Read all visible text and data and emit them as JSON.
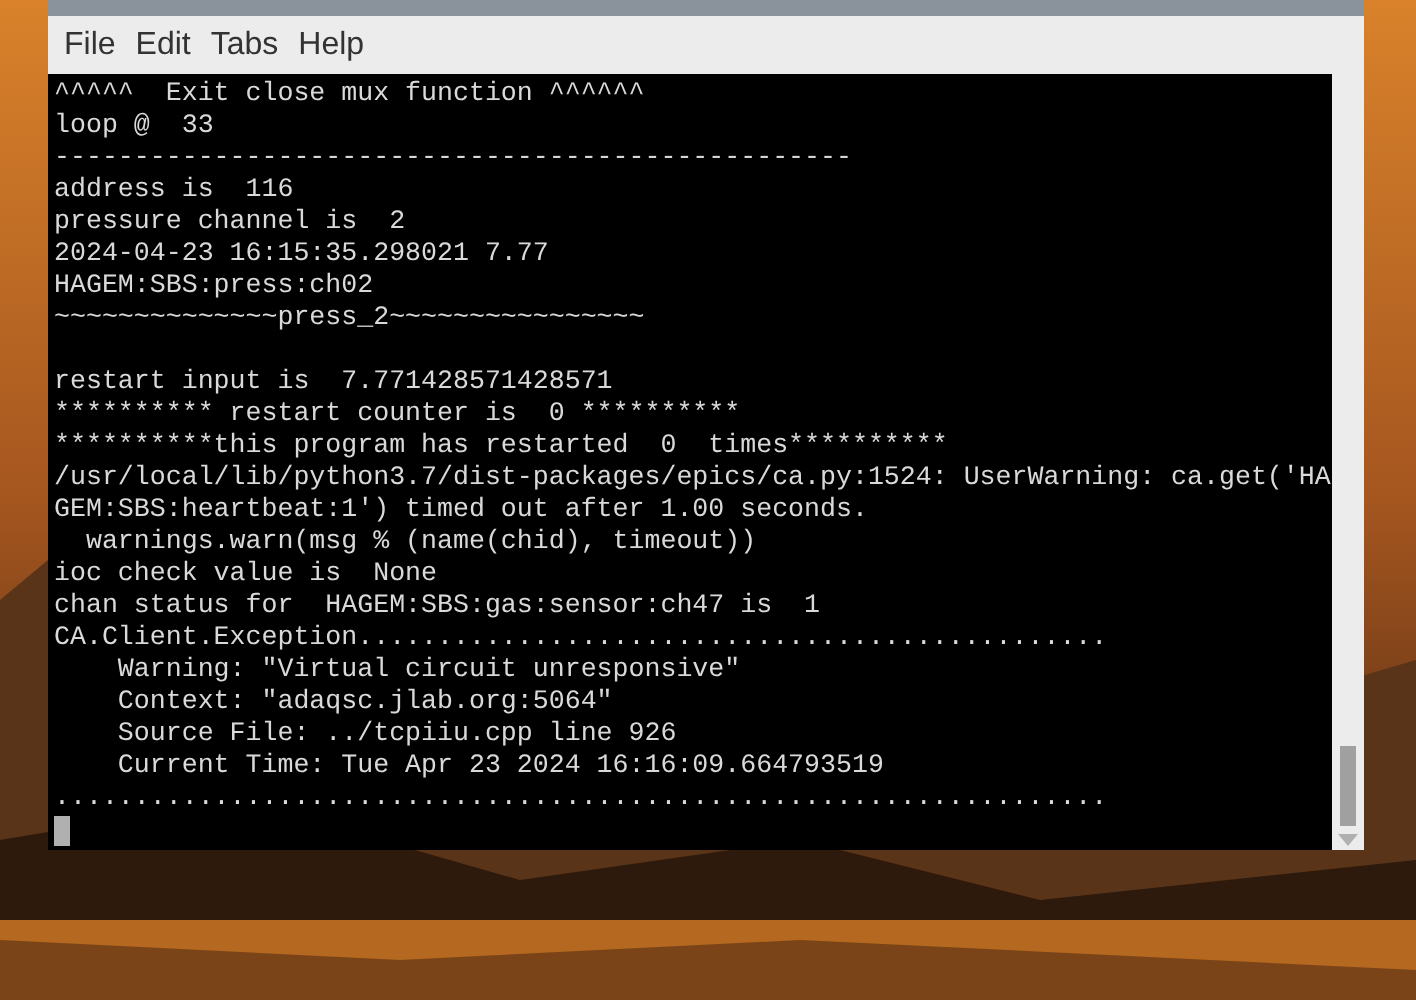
{
  "menu": [
    "File",
    "Edit",
    "Tabs",
    "Help"
  ],
  "terminal": {
    "lines": [
      {
        "kind": "text",
        "text": "^^^^^  Exit close mux function ^^^^^^"
      },
      {
        "kind": "text",
        "text": "loop @  33"
      },
      {
        "kind": "text",
        "text": "--------------------------------------------------"
      },
      {
        "kind": "text",
        "text": "address is  116"
      },
      {
        "kind": "text",
        "text": "pressure channel is  2"
      },
      {
        "kind": "text",
        "text": "2024-04-23 16:15:35.298021 7.77"
      },
      {
        "kind": "text",
        "text": "HAGEM:SBS:press:ch02"
      },
      {
        "kind": "text",
        "text": "~~~~~~~~~~~~~~press_2~~~~~~~~~~~~~~~~"
      },
      {
        "kind": "blank"
      },
      {
        "kind": "text",
        "text": "restart input is  7.771428571428571"
      },
      {
        "kind": "text",
        "text": "********** restart counter is  0 **********"
      },
      {
        "kind": "text",
        "text": "**********this program has restarted  0  times**********"
      },
      {
        "kind": "text",
        "text": "/usr/local/lib/python3.7/dist-packages/epics/ca.py:1524: UserWarning: ca.get('HA"
      },
      {
        "kind": "text",
        "text": "GEM:SBS:heartbeat:1') timed out after 1.00 seconds."
      },
      {
        "kind": "text",
        "text": "  warnings.warn(msg % (name(chid), timeout))"
      },
      {
        "kind": "text",
        "text": "ioc check value is  None"
      },
      {
        "kind": "text",
        "text": "chan status for  HAGEM:SBS:gas:sensor:ch47 is  1"
      },
      {
        "kind": "text",
        "text": "CA.Client.Exception..............................................."
      },
      {
        "kind": "text",
        "text": "    Warning: \"Virtual circuit unresponsive\""
      },
      {
        "kind": "text",
        "text": "    Context: \"adaqsc.jlab.org:5064\""
      },
      {
        "kind": "text",
        "text": "    Source File: ../tcpiiu.cpp line 926"
      },
      {
        "kind": "text",
        "text": "    Current Time: Tue Apr 23 2024 16:16:09.664793519"
      },
      {
        "kind": "text",
        "text": ".................................................................."
      },
      {
        "kind": "cursor"
      }
    ]
  }
}
